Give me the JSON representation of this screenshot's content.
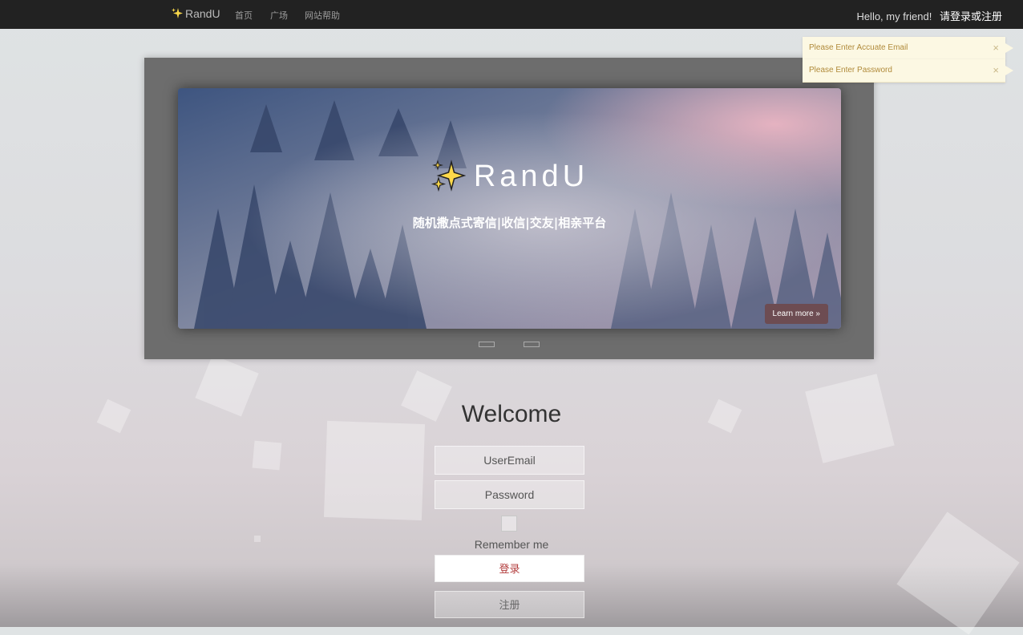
{
  "navbar": {
    "brand": "RandU",
    "links": [
      "首页",
      "广场",
      "网站帮助"
    ],
    "greeting": "Hello, my friend!",
    "auth_link": "请登录或注册"
  },
  "carousel": {
    "title": "RandU",
    "subtitle": "随机撒点式寄信|收信|交友|相亲平台",
    "button": "Learn more »",
    "active_slide": 1,
    "slide_count": 2
  },
  "login": {
    "heading": "Welcome",
    "email_placeholder": "UserEmail",
    "password_placeholder": "Password",
    "remember_label": "Remember me",
    "login_button": "登录",
    "register_button": "注册"
  },
  "toasts": [
    {
      "message": "Please Enter Accuate Email",
      "close": "×"
    },
    {
      "message": "Please Enter Password",
      "close": "×"
    }
  ],
  "colors": {
    "navbar_bg": "#222222",
    "carousel_frame": "#6d6d6d",
    "learn_button": "#6d4c52",
    "toast_bg": "#fcf8e3",
    "toast_text": "#b08a3a",
    "login_text": "#b23b3b"
  },
  "icons": {
    "brand": "sparkles-icon",
    "close": "close-icon"
  }
}
